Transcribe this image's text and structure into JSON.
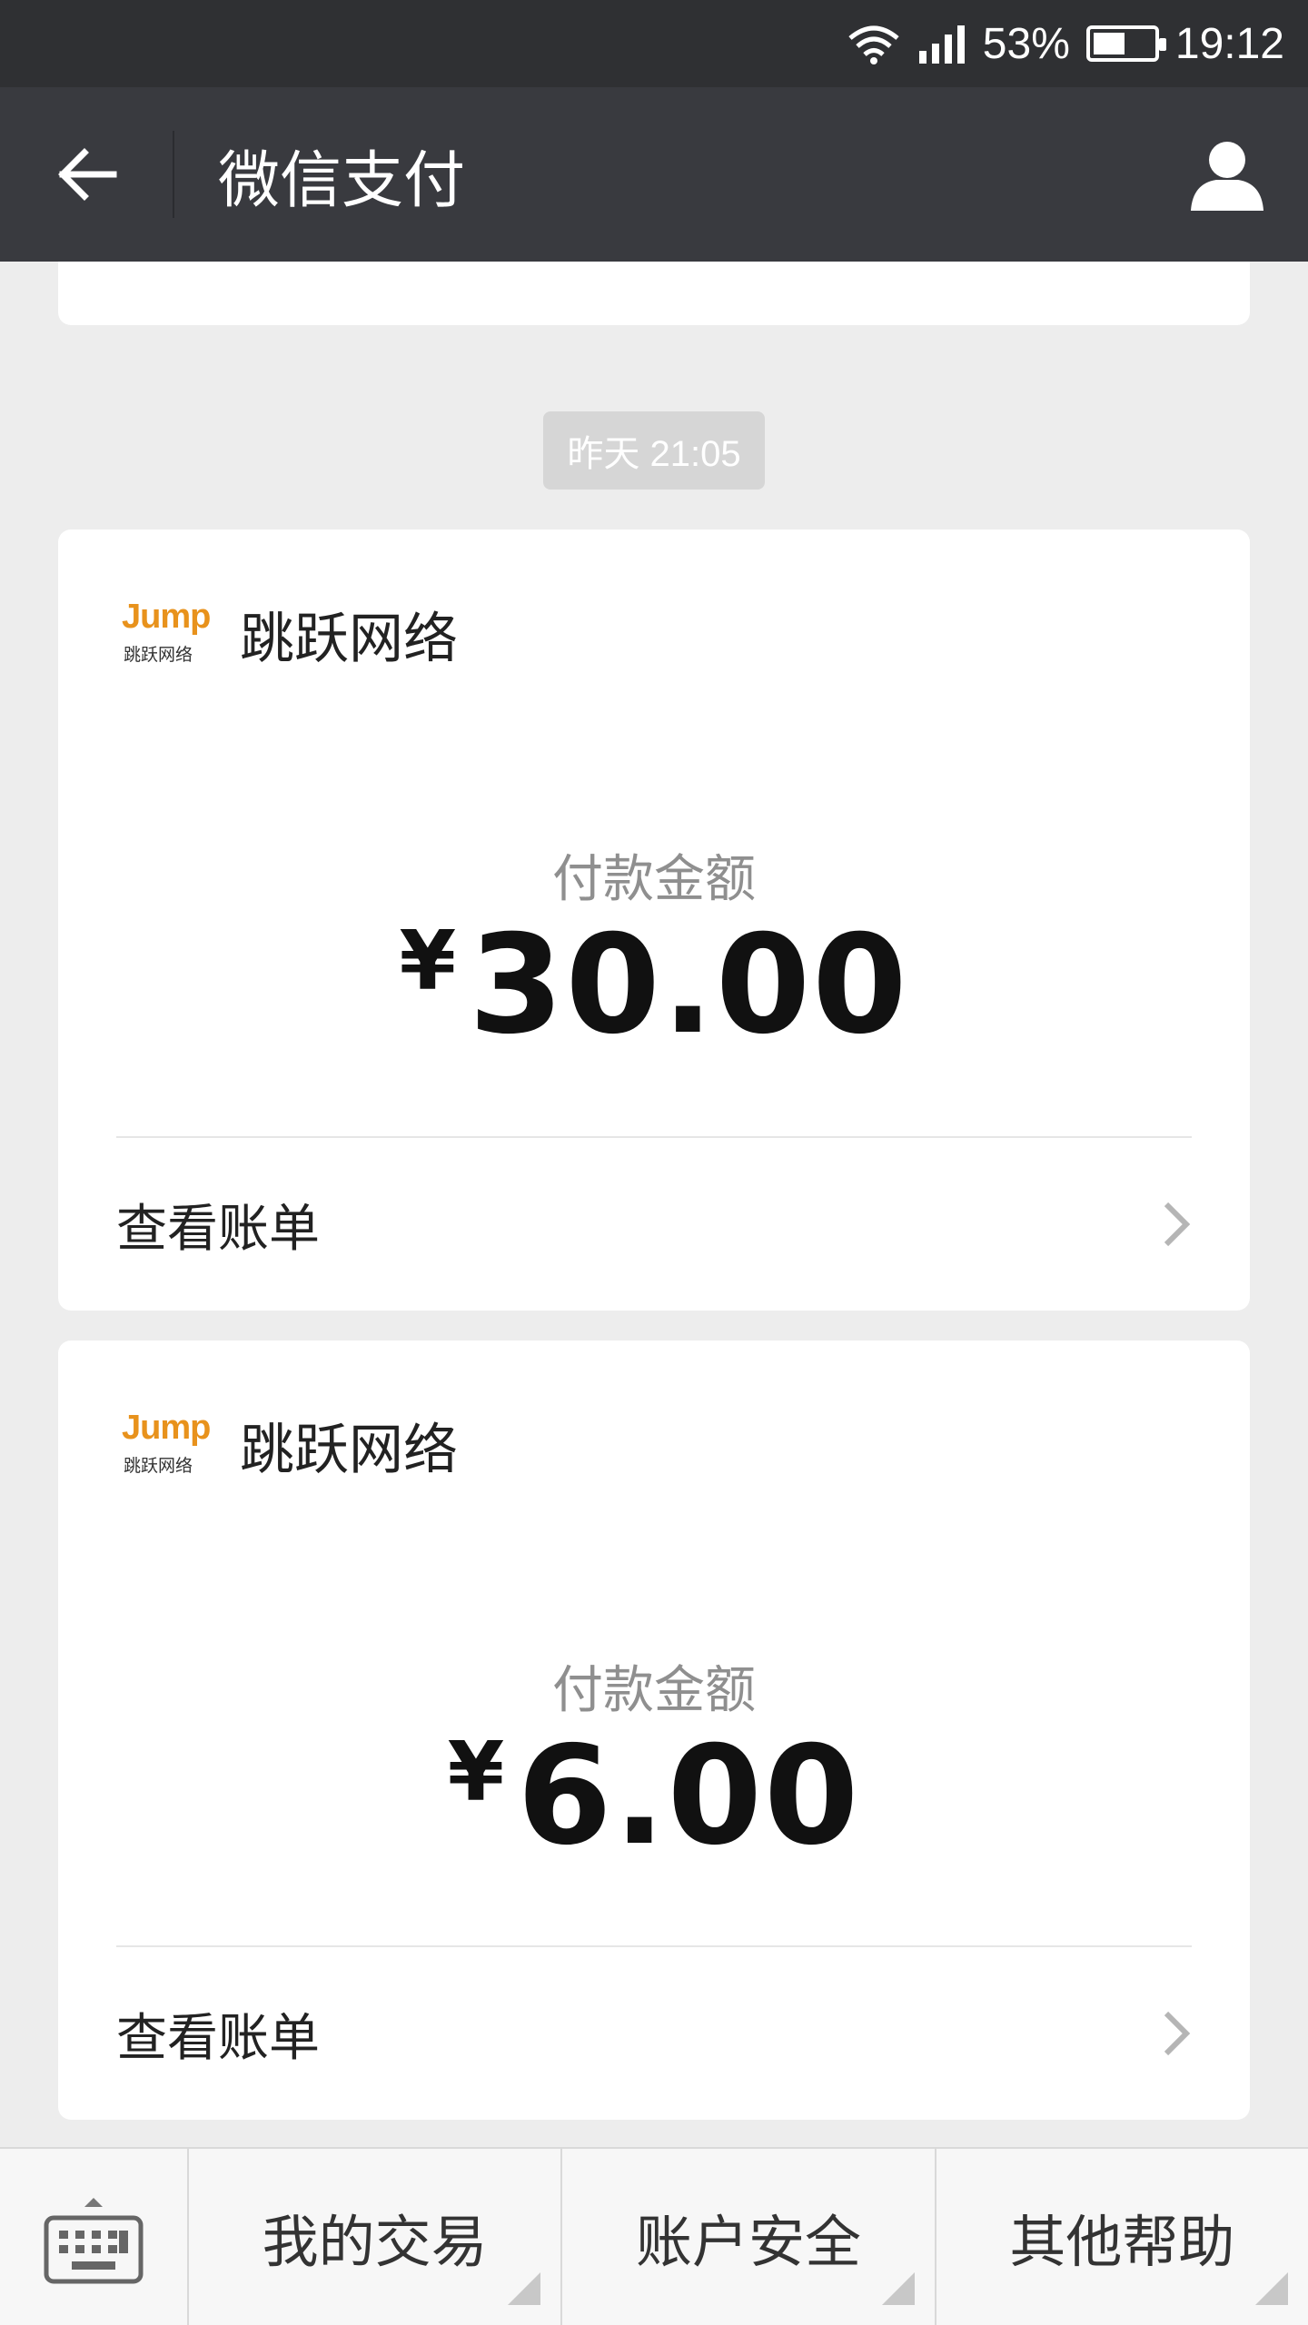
{
  "status_bar": {
    "battery_percent": "53%",
    "battery_level": 0.53,
    "time": "19:12"
  },
  "header": {
    "title": "微信支付",
    "back_icon": "arrow-left-icon",
    "profile_icon": "person-icon"
  },
  "timestamp": "昨天 21:05",
  "cards": [
    {
      "logo_text": "Jump",
      "logo_subtext": "跳跃网络",
      "merchant": "跳跃网络",
      "amount_label": "付款金额",
      "currency": "¥",
      "amount": "30.00",
      "bill_label": "查看账单"
    },
    {
      "logo_text": "Jump",
      "logo_subtext": "跳跃网络",
      "merchant": "跳跃网络",
      "amount_label": "付款金额",
      "currency": "¥",
      "amount": "6.00",
      "bill_label": "查看账单"
    }
  ],
  "bottom_menu": {
    "keyboard_icon": "keyboard-icon",
    "items": [
      {
        "label": "我的交易"
      },
      {
        "label": "账户安全"
      },
      {
        "label": "其他帮助"
      }
    ]
  },
  "colors": {
    "title_bar": "#393a3f",
    "status_bar": "#2f3033",
    "background": "#ededed",
    "logo_orange": "#e8921c"
  }
}
